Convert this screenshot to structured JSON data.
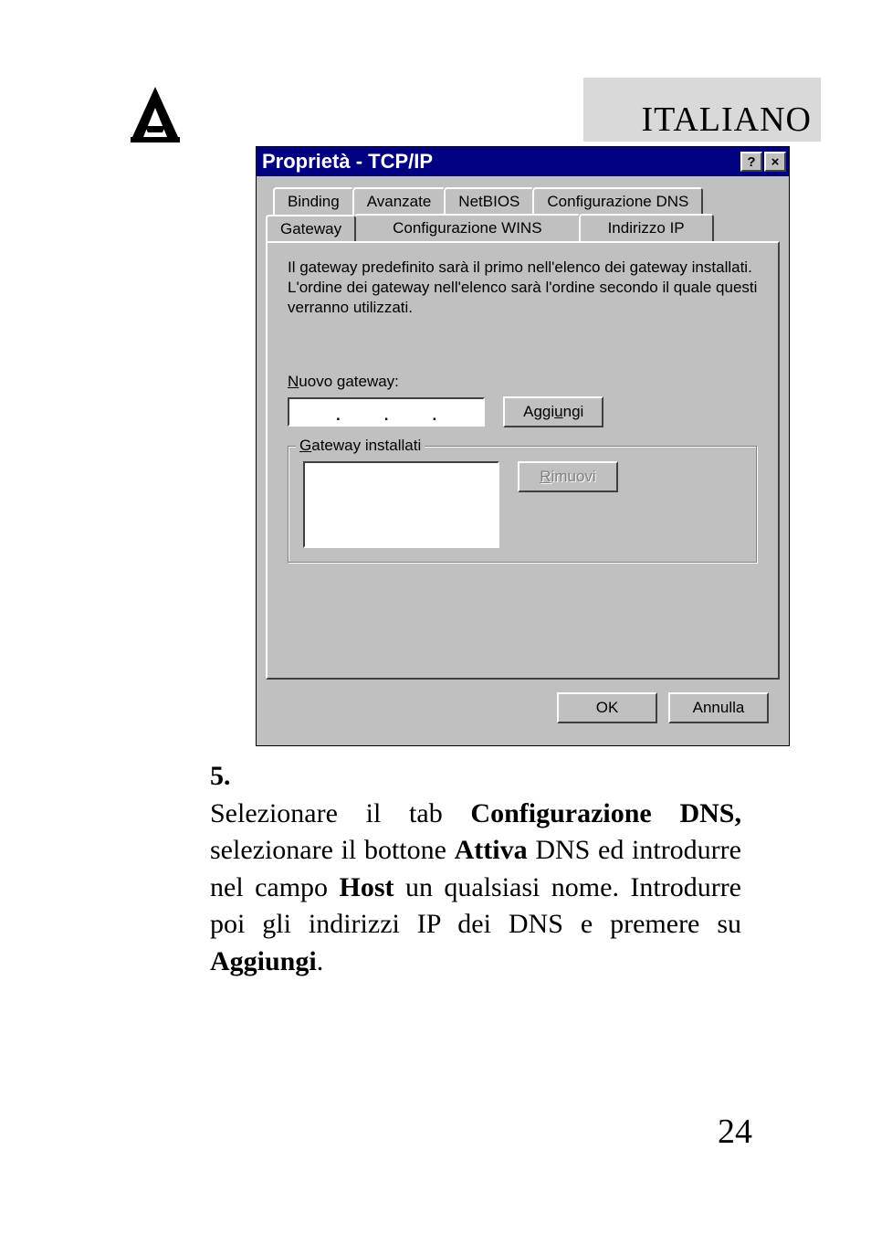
{
  "header": {
    "language_label": "ITALIANO"
  },
  "dialog": {
    "title": "Proprietà - TCP/IP",
    "help_btn": "?",
    "close_btn": "×",
    "tabs_row1": {
      "binding": "Binding",
      "avanzate": "Avanzate",
      "netbios": "NetBIOS",
      "conf_dns": "Configurazione DNS"
    },
    "tabs_row2": {
      "gateway": "Gateway",
      "conf_wins": "Configurazione WINS",
      "indirizzo_ip": "Indirizzo IP"
    },
    "description": "Il gateway predefinito sarà il primo nell'elenco dei gateway installati. L'ordine dei gateway nell'elenco sarà l'ordine secondo il quale questi verranno utilizzati.",
    "nuovo_gateway_prefix": "N",
    "nuovo_gateway_rest": "uovo gateway:",
    "aggiungi_prefix": "Aggi",
    "aggiungi_u": "u",
    "aggiungi_rest": "ngi",
    "gateway_inst_prefix": "G",
    "gateway_inst_rest": "ateway installati",
    "rimuovi_prefix": "R",
    "rimuovi_rest": "imuovi",
    "ok": "OK",
    "annulla": "Annulla"
  },
  "instruction": {
    "number": "5.",
    "text_parts": {
      "p1": "Selezionare il tab ",
      "b1": "Configurazione DNS, ",
      "p2": "selezionare il bottone ",
      "b2": "Attiva ",
      "p3": "DNS ed introdurre nel campo ",
      "b3": "Host ",
      "p4": "un qualsiasi nome. Introdurre poi gli indirizzi IP dei DNS e premere su ",
      "b4": "Aggiungi",
      "p5": "."
    }
  },
  "page_number": "24"
}
